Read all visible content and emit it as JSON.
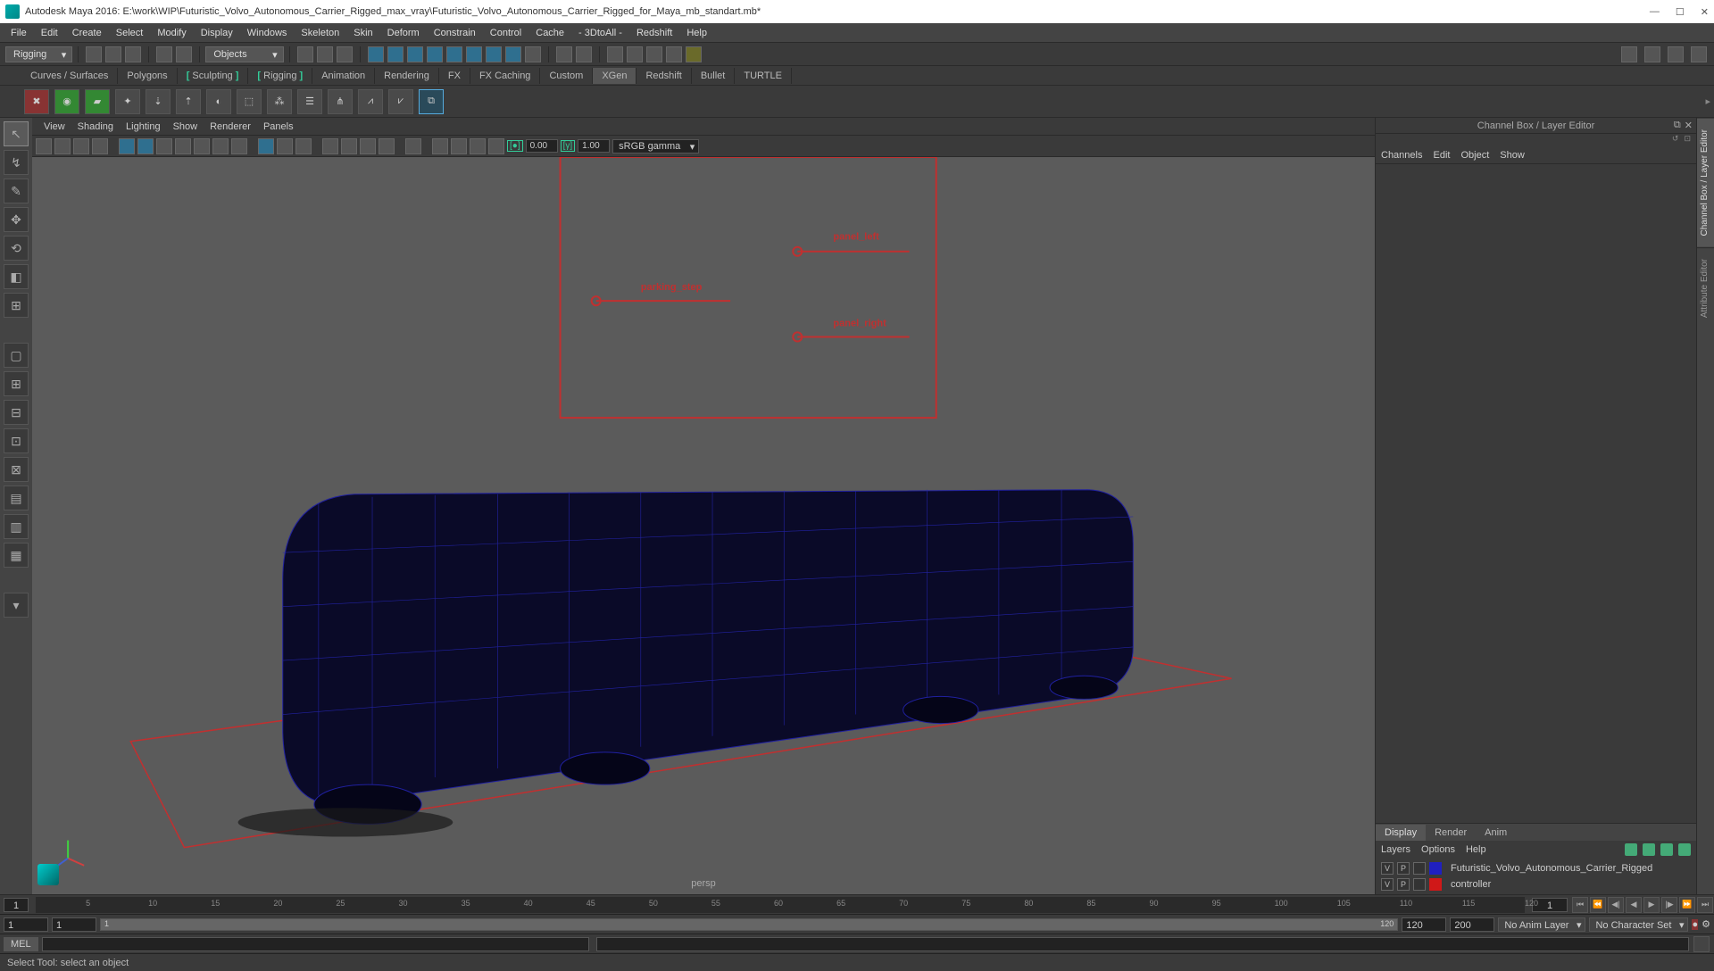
{
  "title": "Autodesk Maya 2016: E:\\work\\WIP\\Futuristic_Volvo_Autonomous_Carrier_Rigged_max_vray\\Futuristic_Volvo_Autonomous_Carrier_Rigged_for_Maya_mb_standart.mb*",
  "menus": [
    "File",
    "Edit",
    "Create",
    "Select",
    "Modify",
    "Display",
    "Windows",
    "Skeleton",
    "Skin",
    "Deform",
    "Constrain",
    "Control",
    "Cache",
    "- 3DtoAll -",
    "Redshift",
    "Help"
  ],
  "mode_dd": "Rigging",
  "objects_dd": "Objects",
  "shelf_tabs": [
    "Curves / Surfaces",
    "Polygons",
    "Sculpting",
    "Rigging",
    "Animation",
    "Rendering",
    "FX",
    "FX Caching",
    "Custom",
    "XGen",
    "Redshift",
    "Bullet",
    "TURTLE"
  ],
  "shelf_active": "XGen",
  "vp_menus": [
    "View",
    "Shading",
    "Lighting",
    "Show",
    "Renderer",
    "Panels"
  ],
  "exposure": "0.00",
  "gamma": "1.00",
  "colorspace": "sRGB gamma",
  "camera": "persp",
  "rig_labels": {
    "panel_left": "panel_left",
    "parking_step": "parking_step",
    "panel_right": "panel_right"
  },
  "channel_title": "Channel Box / Layer Editor",
  "channel_menus": [
    "Channels",
    "Edit",
    "Object",
    "Show"
  ],
  "layer_tabs": [
    "Display",
    "Render",
    "Anim"
  ],
  "layer_tab_active": "Display",
  "layer_menus": [
    "Layers",
    "Options",
    "Help"
  ],
  "layers": [
    {
      "v": "V",
      "p": "P",
      "color": "#2020c0",
      "name": "Futuristic_Volvo_Autonomous_Carrier_Rigged"
    },
    {
      "v": "V",
      "p": "P",
      "color": "#d01818",
      "name": "controller"
    }
  ],
  "side_tabs": [
    "Channel Box / Layer Editor",
    "Attribute Editor"
  ],
  "time": {
    "cur": "1",
    "start": "1",
    "end": "120",
    "range_a": "120",
    "range_b": "200",
    "ticks": [
      5,
      10,
      15,
      20,
      25,
      30,
      35,
      40,
      45,
      50,
      55,
      60,
      65,
      70,
      75,
      80,
      85,
      90,
      95,
      100,
      105,
      110,
      115,
      120
    ]
  },
  "anim_layer": "No Anim Layer",
  "char_set": "No Character Set",
  "cmd_lang": "MEL",
  "help": "Select Tool: select an object"
}
